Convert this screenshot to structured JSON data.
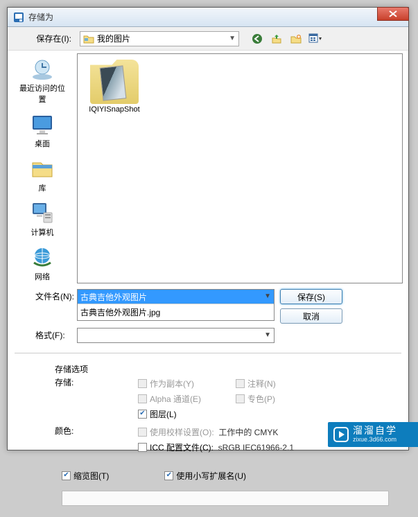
{
  "title": "存储为",
  "toolbar": {
    "save_in_label": "保存在(I):",
    "location": "我的图片"
  },
  "sidebar": {
    "items": [
      {
        "label": "最近访问的位置"
      },
      {
        "label": "桌面"
      },
      {
        "label": "库"
      },
      {
        "label": "计算机"
      },
      {
        "label": "网络"
      }
    ]
  },
  "files": {
    "items": [
      {
        "label": "IQIYISnapShot"
      }
    ]
  },
  "labels": {
    "filename": "文件名(N):",
    "format": "格式(F):"
  },
  "filename": {
    "value": "古典吉他外观图片",
    "dropdown_item": "古典吉他外观图片.jpg"
  },
  "format": {
    "value": ""
  },
  "buttons": {
    "save": "保存(S)",
    "cancel": "取消"
  },
  "options": {
    "section_title": "存储选项",
    "store_label": "存储:",
    "as_copy": "作为副本(Y)",
    "annotations": "注释(N)",
    "alpha": "Alpha 通道(E)",
    "spot": "专色(P)",
    "layers": "图层(L)",
    "color_label": "颜色:",
    "proof": "使用校样设置(O):",
    "proof_target": "工作中的 CMYK",
    "icc": "ICC 配置文件(C):",
    "icc_profile": "sRGB IEC61966-2.1",
    "thumbnail": "缩览图(T)",
    "lowercase_ext": "使用小写扩展名(U)"
  },
  "watermark": {
    "main": "溜溜自学",
    "sub": "zixue.3d66.com"
  }
}
